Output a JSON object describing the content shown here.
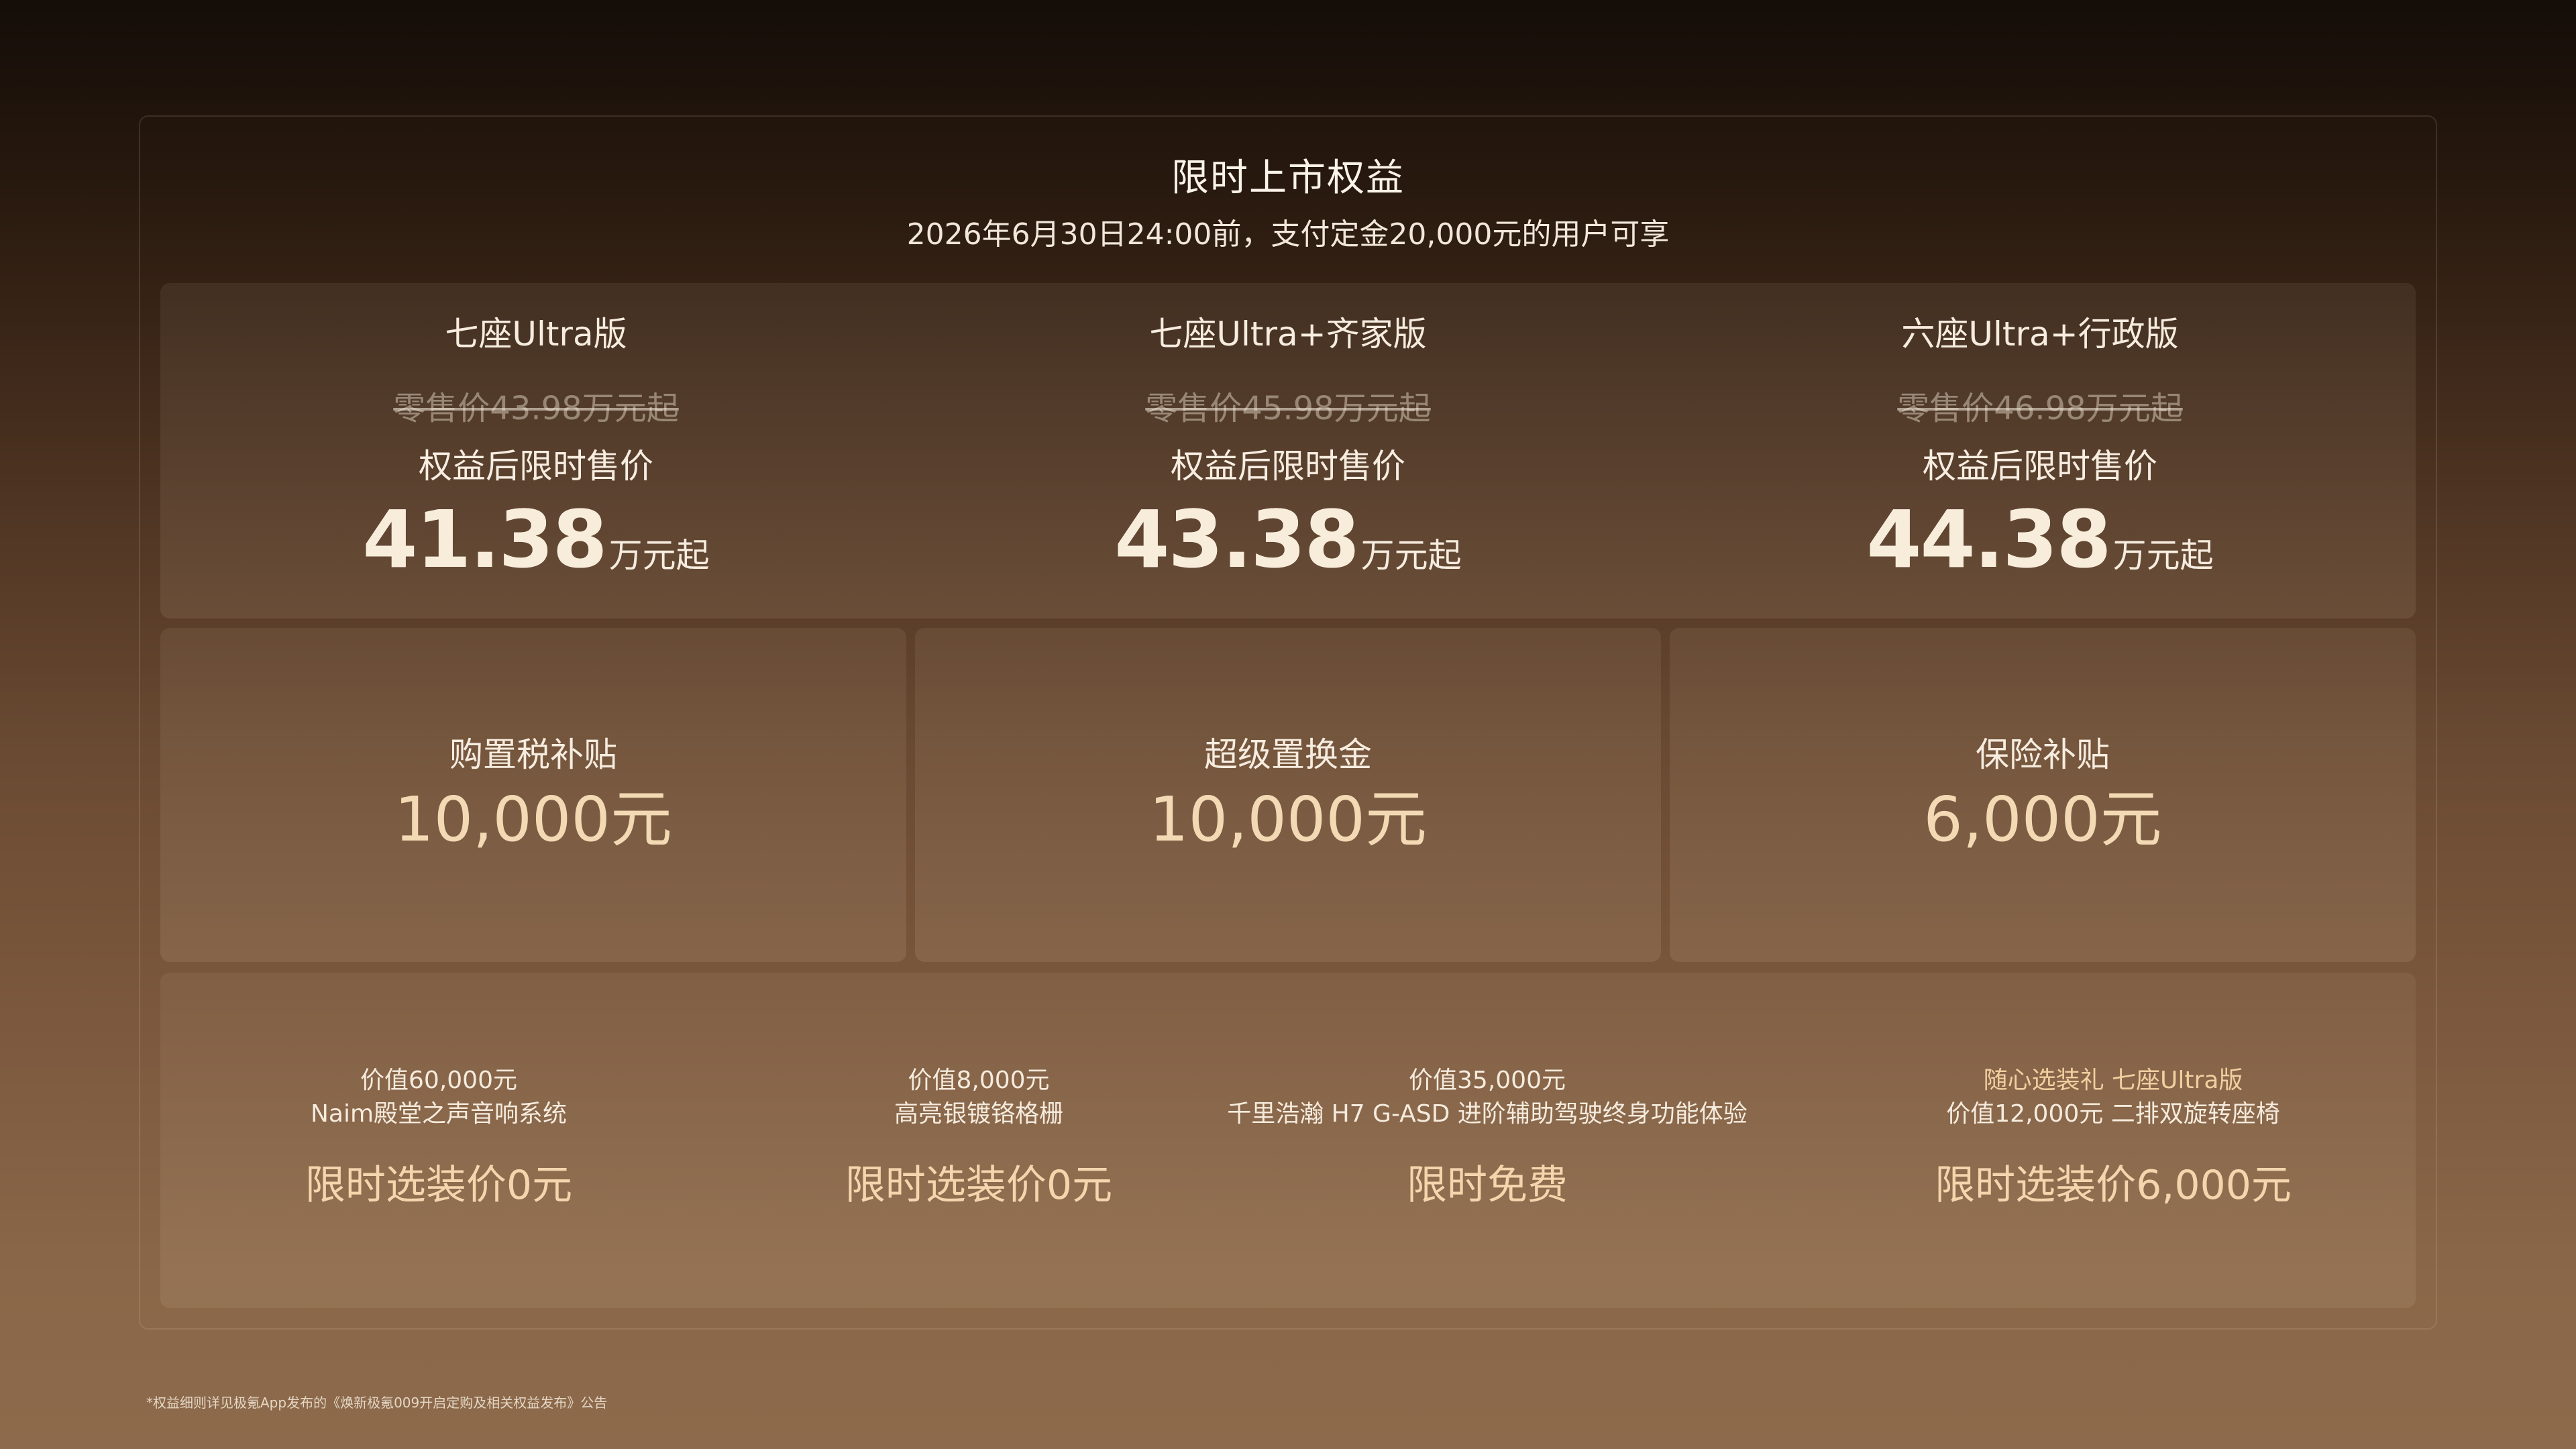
{
  "header": {
    "title": "限时上市权益",
    "subtitle": "2026年6月30日24:00前，支付定金20,000元的用户可享"
  },
  "versions": [
    {
      "name": "七座Ultra版",
      "retail_price": "零售价43.98万元起",
      "limited_label": "权益后限时售价",
      "limited_price": "41.38",
      "unit": "万元起"
    },
    {
      "name": "七座Ultra+齐家版",
      "retail_price": "零售价45.98万元起",
      "limited_label": "权益后限时售价",
      "limited_price": "43.38",
      "unit": "万元起"
    },
    {
      "name": "六座Ultra+行政版",
      "retail_price": "零售价46.98万元起",
      "limited_label": "权益后限时售价",
      "limited_price": "44.38",
      "unit": "万元起"
    }
  ],
  "subsidies": [
    {
      "name": "购置税补贴",
      "amount": "10,000元"
    },
    {
      "name": "超级置换金",
      "amount": "10,000元"
    },
    {
      "name": "保险补贴",
      "amount": "6,000元"
    }
  ],
  "options": [
    {
      "line1": "价值60,000元",
      "line2": "Naim殿堂之声音响系统",
      "deal": "限时选装价0元"
    },
    {
      "line1": "价值8,000元",
      "line2": "高亮银镀铬格栅",
      "deal": "限时选装价0元"
    },
    {
      "line1": "价值35,000元",
      "line2": "千里浩瀚 H7 G-ASD 进阶辅助驾驶终身功能体验",
      "deal": "限时免费"
    },
    {
      "line1_accent": "随心选装礼 七座Ultra版",
      "line2": "价值12,000元 二排双旋转座椅",
      "deal": "限时选装价6,000元"
    }
  ],
  "footnote": "*权益细则详见极氪App发布的《焕新极氪009开启定购及相关权益发布》公告",
  "colors": {
    "gold_accent": "#f3d6ad",
    "text_primary": "#f6ecdf",
    "background_top": "#140d08",
    "background_bottom": "#8c6a4b"
  }
}
